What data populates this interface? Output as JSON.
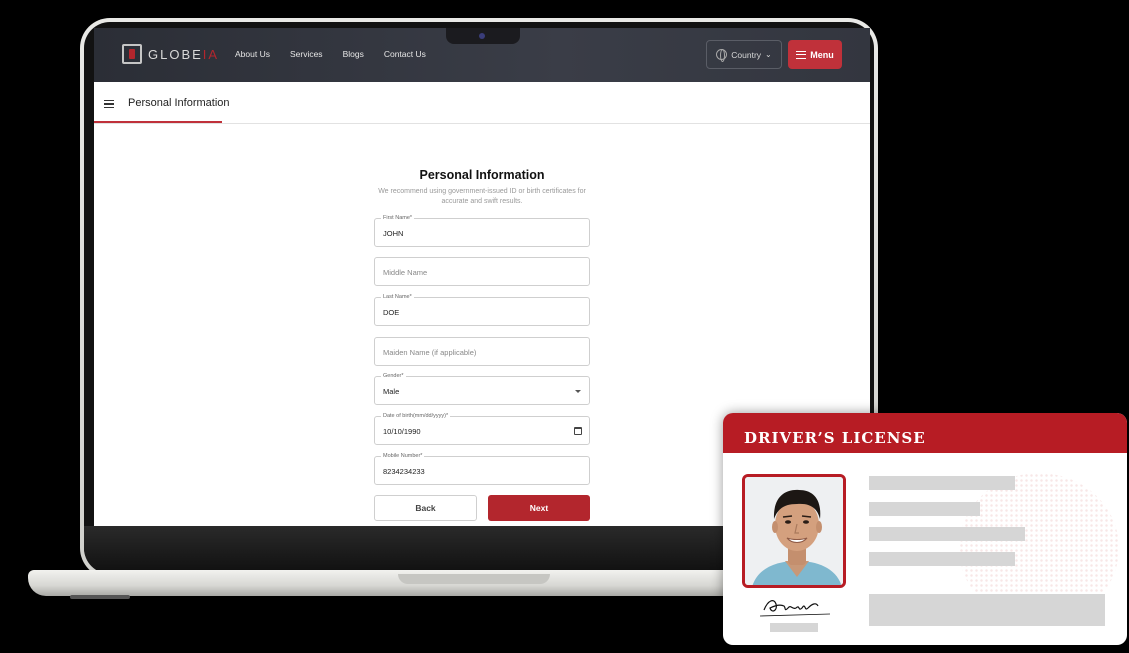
{
  "site": {
    "logo_text": "GLOBE",
    "logo_accent": "IA",
    "nav": [
      "About Us",
      "Services",
      "Blogs",
      "Contact Us"
    ],
    "country_label": "Country",
    "menu_label": "Menu",
    "brand_color": "#b3262d"
  },
  "page": {
    "sub_title": "Personal Information"
  },
  "form": {
    "title": "Personal Information",
    "subtitle": "We recommend using government-issued ID or birth certificates for accurate and swift results.",
    "fields": [
      {
        "label": "First Name*",
        "value": "JOHN",
        "placeholder": ""
      },
      {
        "label": "",
        "value": "",
        "placeholder": "Middle Name"
      },
      {
        "label": "Last Name*",
        "value": "DOE",
        "placeholder": ""
      },
      {
        "label": "",
        "value": "",
        "placeholder": "Maiden Name (if applicable)"
      },
      {
        "label": "Gender*",
        "value": "Male",
        "placeholder": ""
      },
      {
        "label": "Date of birth(mm/dd/yyyy)*",
        "value": "10/10/1990",
        "placeholder": ""
      },
      {
        "label": "Mobile Number*",
        "value": "8234234233",
        "placeholder": ""
      }
    ],
    "back_label": "Back",
    "next_label": "Next"
  },
  "license": {
    "title": "DRIVER’S LICENSE",
    "accent_color": "#b71c24"
  }
}
